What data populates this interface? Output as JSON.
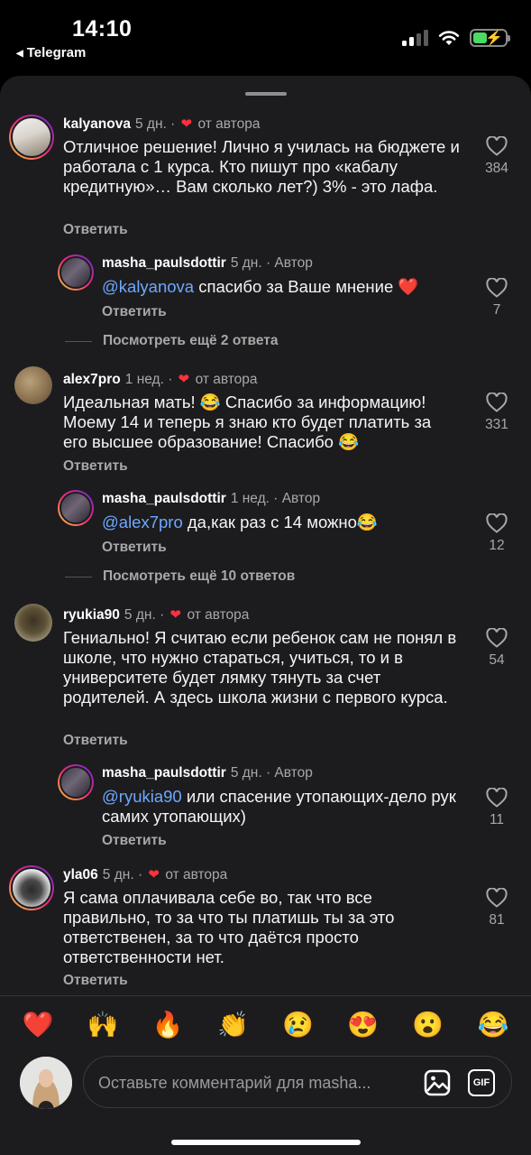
{
  "status_bar": {
    "time": "14:10",
    "back_app": "Telegram"
  },
  "comments": [
    {
      "username": "kalyanova",
      "time": "5 дн. ·",
      "author_tag": "от автора",
      "text": "Отличное решение! Лично я училась на бюджете и работала с 1 курса. Кто пишут про «кабалу кредитную»… Вам сколько лет?) 3% - это лафа.",
      "reply_label": "Ответить",
      "likes": "384"
    },
    {
      "username": "masha_paulsdottir",
      "time": "5 дн. · Автор",
      "mention": "@kalyanova",
      "text": " спасибо за Ваше мнение ❤️",
      "reply_label": "Ответить",
      "likes": "7",
      "more_replies": "Посмотреть ещё 2 ответа"
    },
    {
      "username": "alex7pro",
      "time": "1 нед. ·",
      "author_tag": "от автора",
      "text": "Идеальная мать! 😂 Спасибо за информацию! Моему 14 и теперь я знаю кто будет платить за его высшее образование! Спасибо 😂",
      "reply_label": "Ответить",
      "likes": "331"
    },
    {
      "username": "masha_paulsdottir",
      "time": "1 нед. · Автор",
      "mention": "@alex7pro",
      "text": " да,как раз с 14 можно😂",
      "reply_label": "Ответить",
      "likes": "12",
      "more_replies": "Посмотреть ещё 10 ответов"
    },
    {
      "username": "ryukia90",
      "time": "5 дн. ·",
      "author_tag": "от автора",
      "text": "Гениально! Я считаю если ребенок сам не понял в школе, что нужно стараться, учиться, то и в университете будет лямку тянуть за счет родителей. А здесь школа жизни с первого курса.",
      "reply_label": "Ответить",
      "likes": "54"
    },
    {
      "username": "masha_paulsdottir",
      "time": "5 дн. · Автор",
      "mention": "@ryukia90",
      "text": " или спасение утопающих-дело рук самих утопающих)",
      "reply_label": "Ответить",
      "likes": "11"
    },
    {
      "username": "yla06",
      "time": "5 дн. ·",
      "author_tag": "от автора",
      "text": "Я сама оплачивала себе во, так что все правильно, то за что ты платишь ты за это ответственен, за то что даётся просто ответственности нет.",
      "reply_label": "Ответить",
      "likes": "81"
    }
  ],
  "reactions": [
    "❤️",
    "🙌",
    "🔥",
    "👏",
    "😢",
    "😍",
    "😮",
    "😂"
  ],
  "composer": {
    "placeholder": "Оставьте комментарий для masha...",
    "gif_label": "GIF"
  },
  "colors": {
    "sheet_bg": "#1c1c1e",
    "mention": "#6ea8ff",
    "heart": "#ff3040",
    "muted": "#a8a8a8"
  }
}
